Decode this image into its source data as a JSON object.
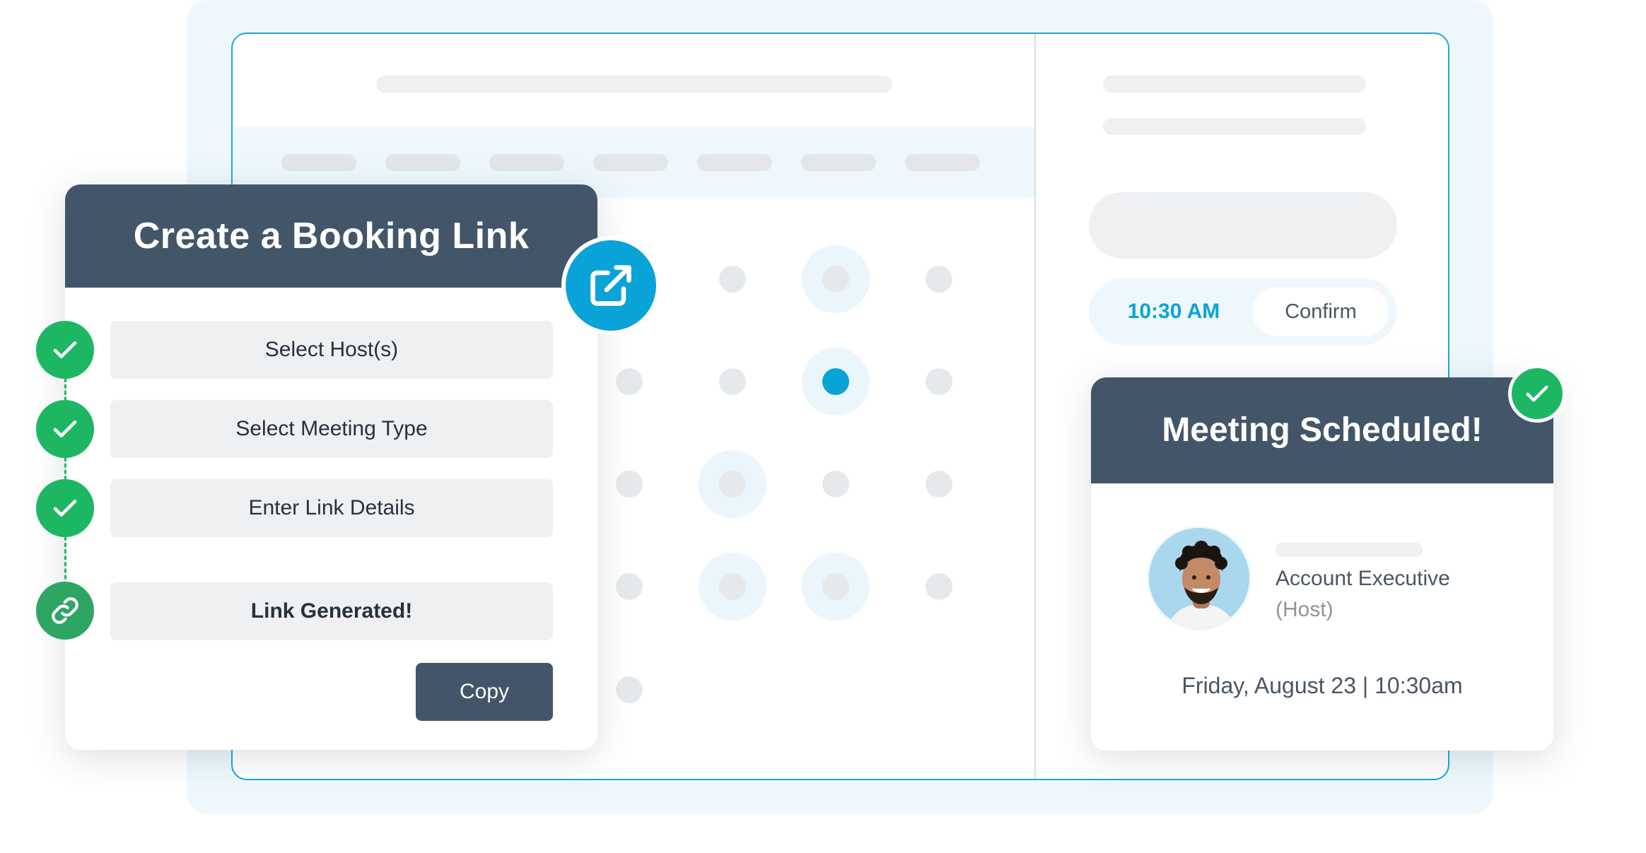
{
  "booking_card": {
    "title": "Create a Booking Link",
    "steps": [
      {
        "label": "Select Host(s)",
        "status": "done",
        "icon": "check-icon"
      },
      {
        "label": "Select Meeting Type",
        "status": "done",
        "icon": "check-icon"
      },
      {
        "label": "Enter Link Details",
        "status": "done",
        "icon": "check-icon"
      },
      {
        "label": "Link Generated!",
        "status": "link",
        "icon": "link-icon"
      }
    ],
    "copy_label": "Copy",
    "external_icon": "external-link-icon"
  },
  "time_picker": {
    "selected_time": "10:30 AM",
    "confirm_label": "Confirm"
  },
  "meeting_card": {
    "title": "Meeting Scheduled!",
    "role": "Account Executive",
    "host_tag": "(Host)",
    "datetime": "Friday, August 23 | 10:30am",
    "badge_icon": "check-icon"
  },
  "colors": {
    "accent_blue": "#0aa3d8",
    "header_slate": "#435669",
    "success_green": "#1db763",
    "frame_bg": "#eef8fc"
  }
}
